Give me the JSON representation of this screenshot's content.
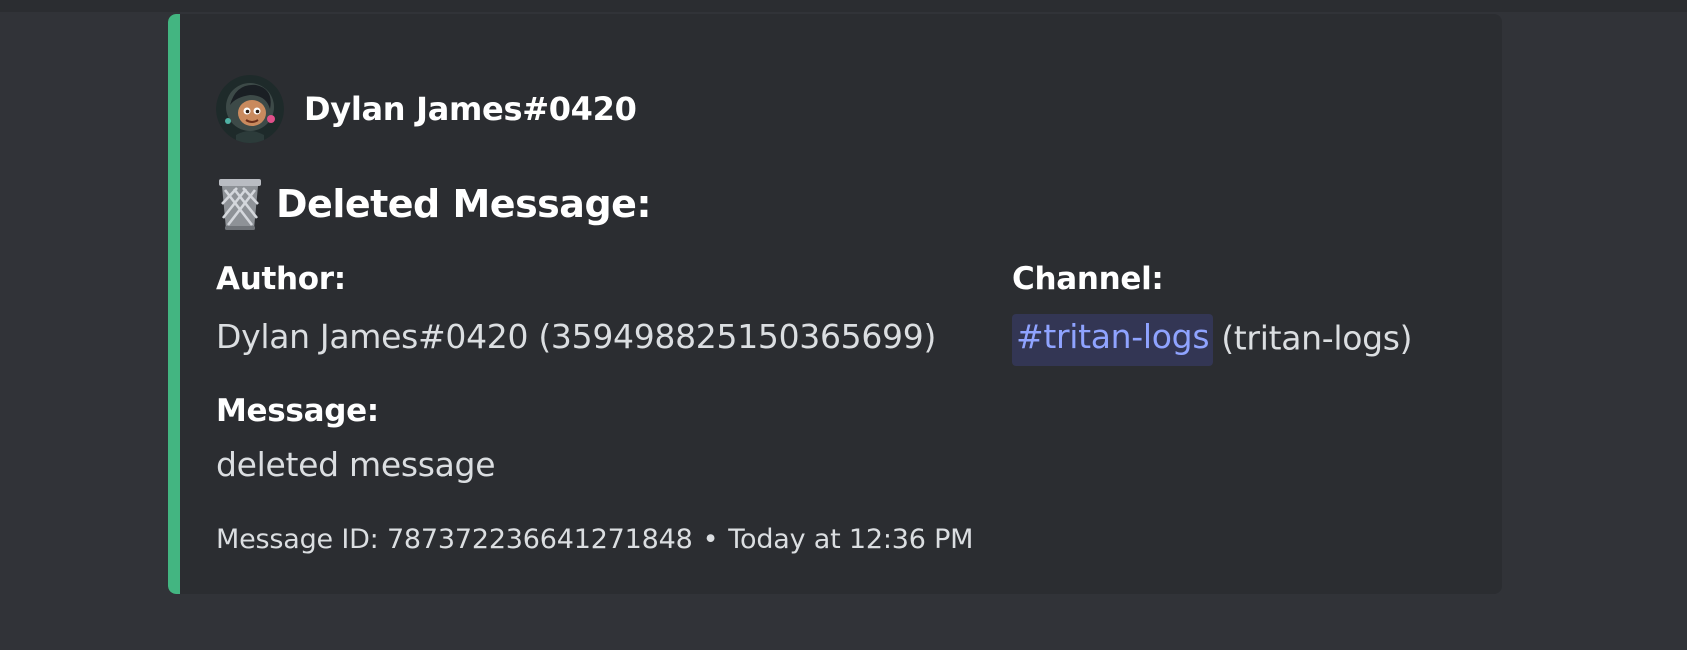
{
  "embed": {
    "accent_color": "#43b581",
    "author": {
      "name": "Dylan James#0420",
      "avatar_icon": "avatar-cartoon-icon"
    },
    "title": {
      "icon": "wastebasket-icon",
      "text": "Deleted Message:"
    },
    "fields": {
      "author": {
        "name": "Author:",
        "value": "Dylan James#0420 (359498825150365699)"
      },
      "channel": {
        "name": "Channel:",
        "mention": "#tritan-logs",
        "value": "(tritan-logs)"
      },
      "message": {
        "name": "Message:",
        "value": "deleted message"
      }
    },
    "footer": {
      "message_id": "Message ID: 787372236641271848",
      "separator": "•",
      "timestamp": "Today at 12:36 PM"
    }
  }
}
